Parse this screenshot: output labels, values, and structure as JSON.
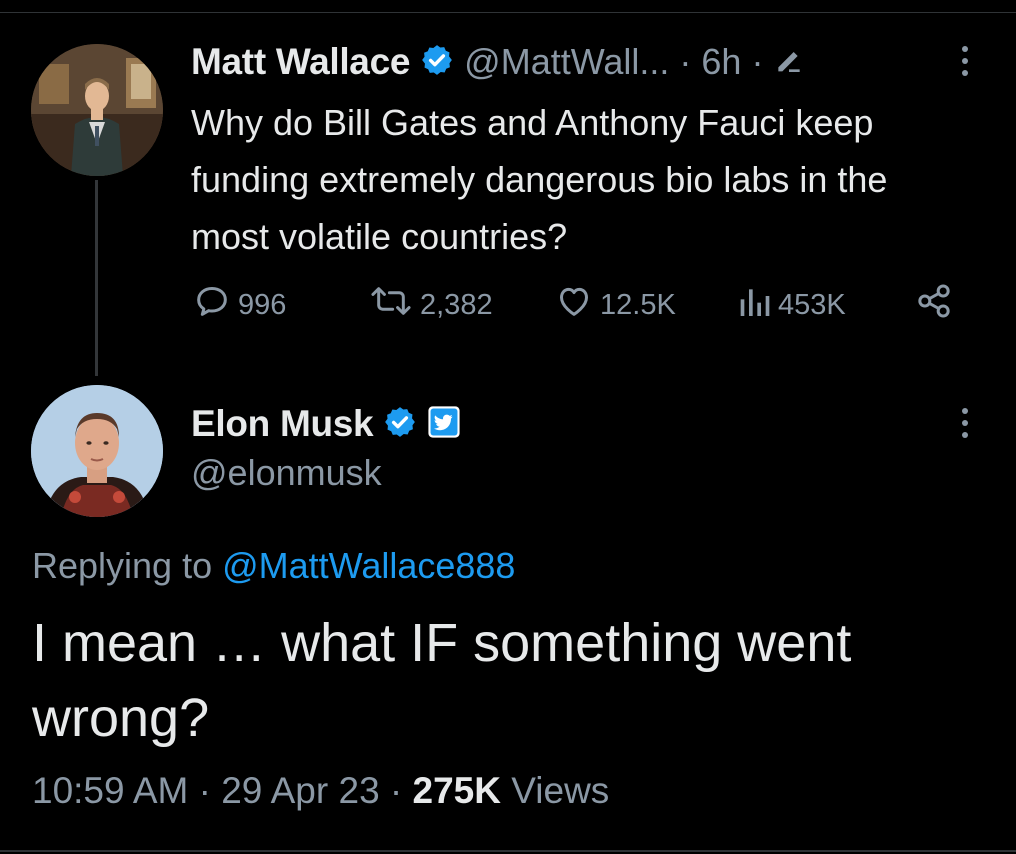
{
  "original_tweet": {
    "author_name": "Matt Wallace",
    "handle": "@MattWall...",
    "separator": "·",
    "time": "6h",
    "text": "Why do Bill Gates and Anthony Fauci keep funding extremely dangerous bio labs in the most volatile countries?",
    "stats": {
      "replies": "996",
      "retweets": "2,382",
      "likes": "12.5K",
      "views": "453K"
    }
  },
  "reply_tweet": {
    "author_name": "Elon Musk",
    "handle": "@elonmusk",
    "replying_prefix": "Replying to",
    "replying_mention": "@MattWallace888",
    "text": "I mean … what IF something went wrong?",
    "time": "10:59 AM",
    "date": "29 Apr 23",
    "views_count": "275K",
    "views_label": "Views"
  },
  "icons": {
    "verified": "verified-badge-icon",
    "twitter_affiliation": "twitter-bird-badge-icon",
    "reply": "reply-bubble-icon",
    "retweet": "retweet-icon",
    "like": "heart-icon",
    "views": "bar-chart-icon",
    "share": "share-icon",
    "more": "more-vertical-icon",
    "edit": "edit-pencil-icon"
  },
  "colors": {
    "background": "#000000",
    "text_primary": "#e7e9ea",
    "text_secondary": "#8b98a5",
    "accent": "#1d9bf0"
  }
}
